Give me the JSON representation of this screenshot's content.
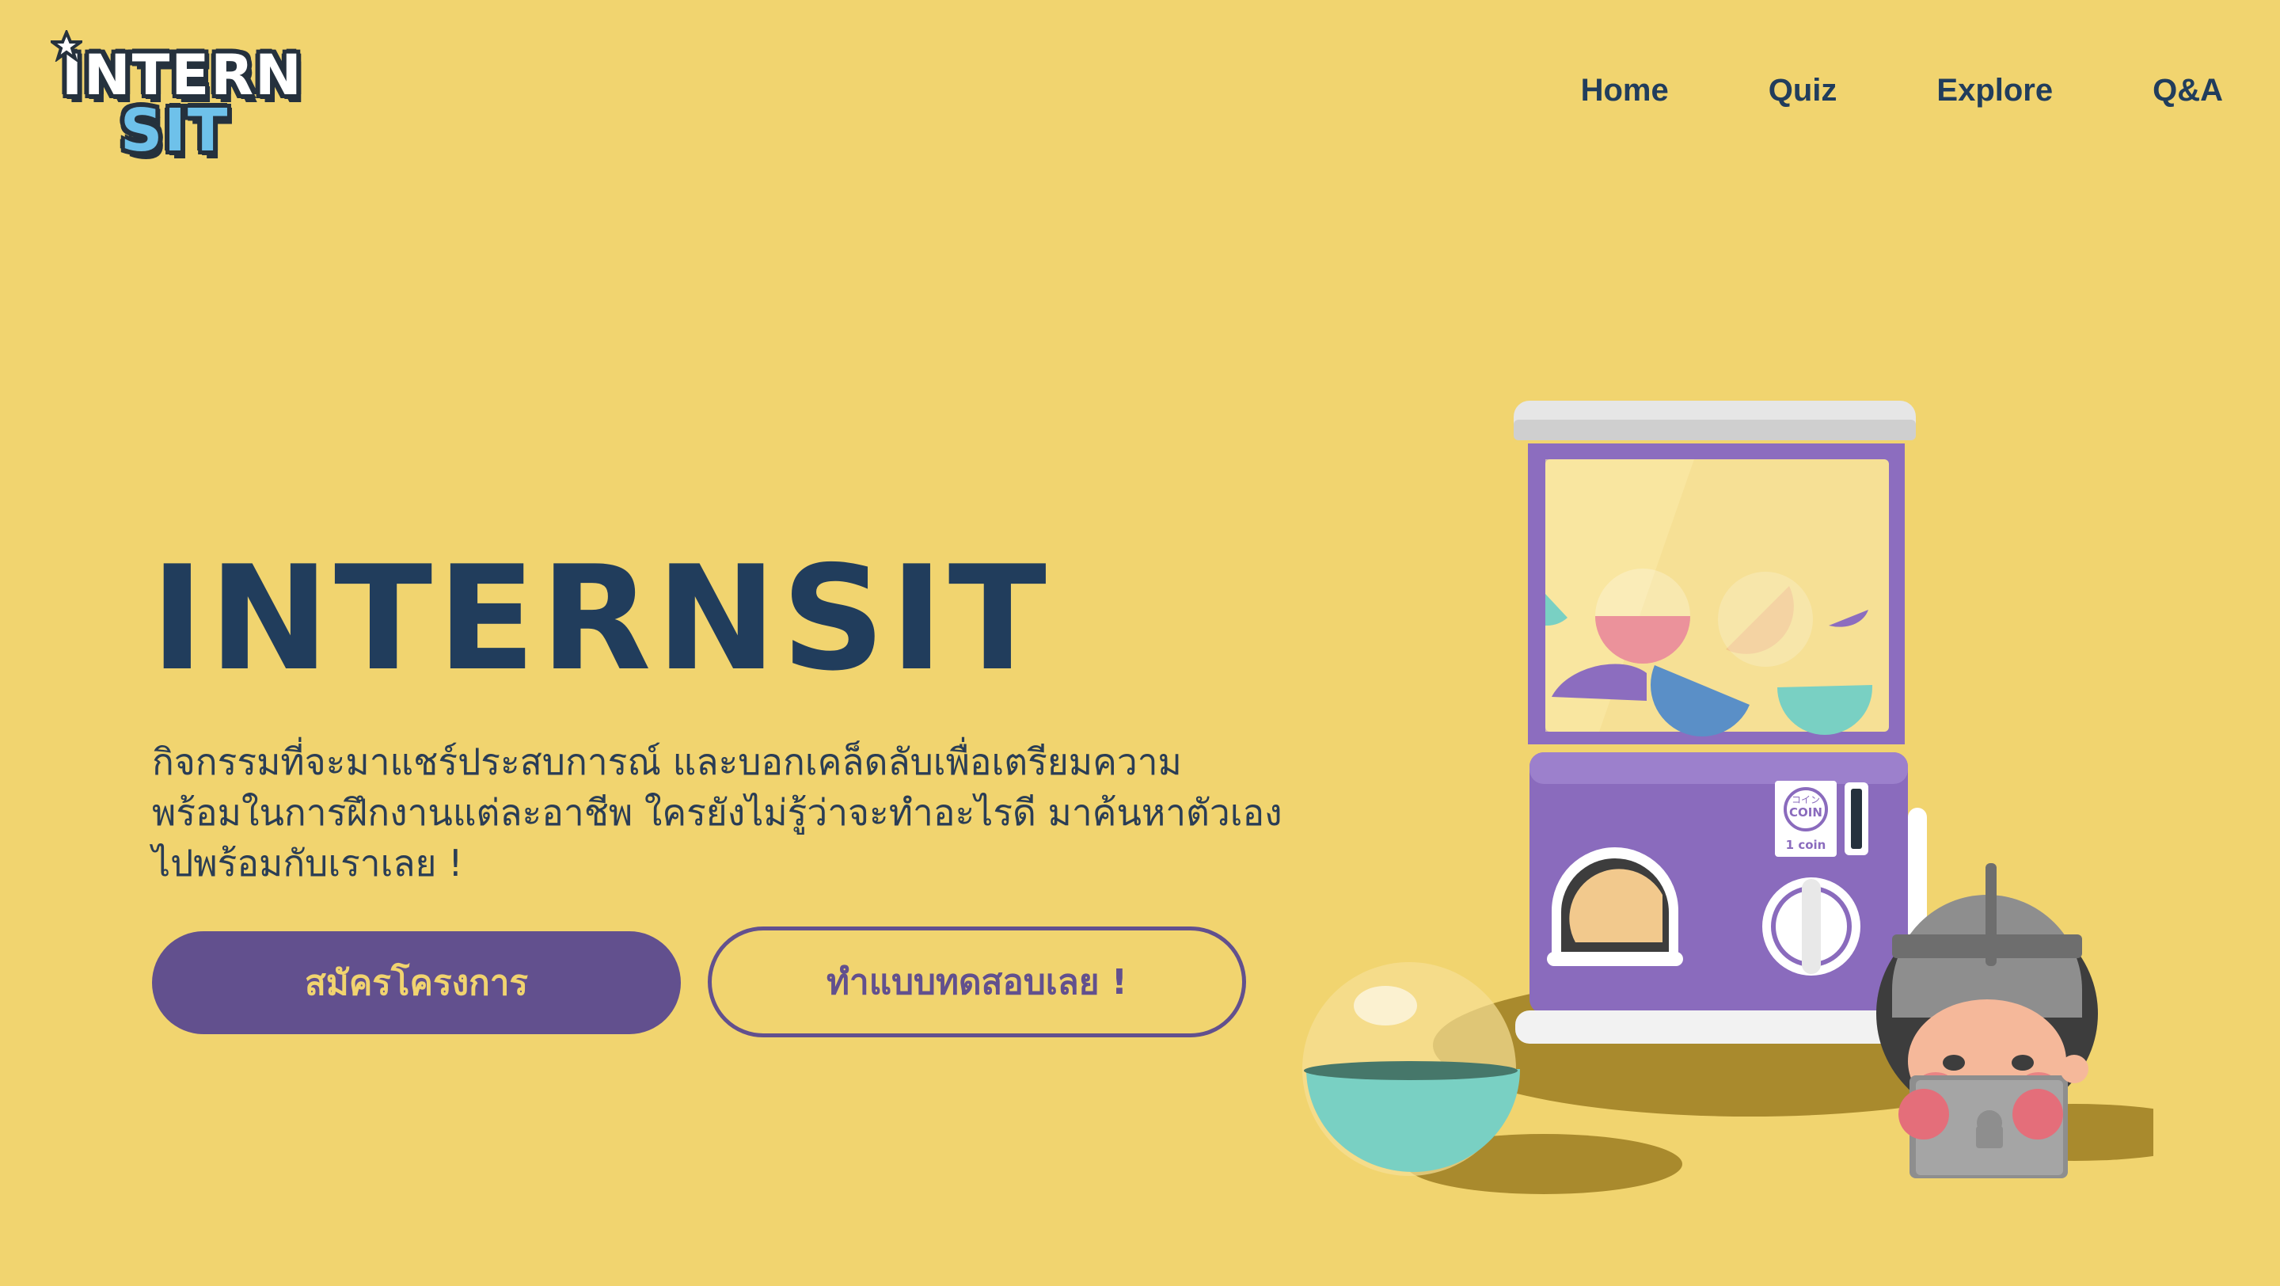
{
  "brand": {
    "logo_top": "INTERN",
    "logo_bottom": "SIT",
    "logo_icon": "star-icon"
  },
  "nav": {
    "items": [
      "Home",
      "Quiz",
      "Explore",
      "Q&A"
    ]
  },
  "hero": {
    "title": "INTERNSIT",
    "description_lines": [
      "กิจกรรมที่จะมาแชร์ประสบการณ์ และบอกเคล็ดลับเพื่อเตรียมความ",
      "พร้อมในการฝึกงานแต่ละอาชีพ ใครยังไม่รู้ว่าจะทำอะไรดี มาค้นหาตัวเอง",
      "ไปพร้อมกับเราเลย !"
    ],
    "primary_button": "สมัครโครงการ",
    "secondary_button": "ทำแบบทดสอบเลย !"
  },
  "machine": {
    "coin_label_jp": "コイン",
    "coin_label": "COIN",
    "coin_price": "1 coin"
  },
  "colors": {
    "background": "#f1d46f",
    "navy": "#213d5c",
    "purple": "#62508e"
  }
}
